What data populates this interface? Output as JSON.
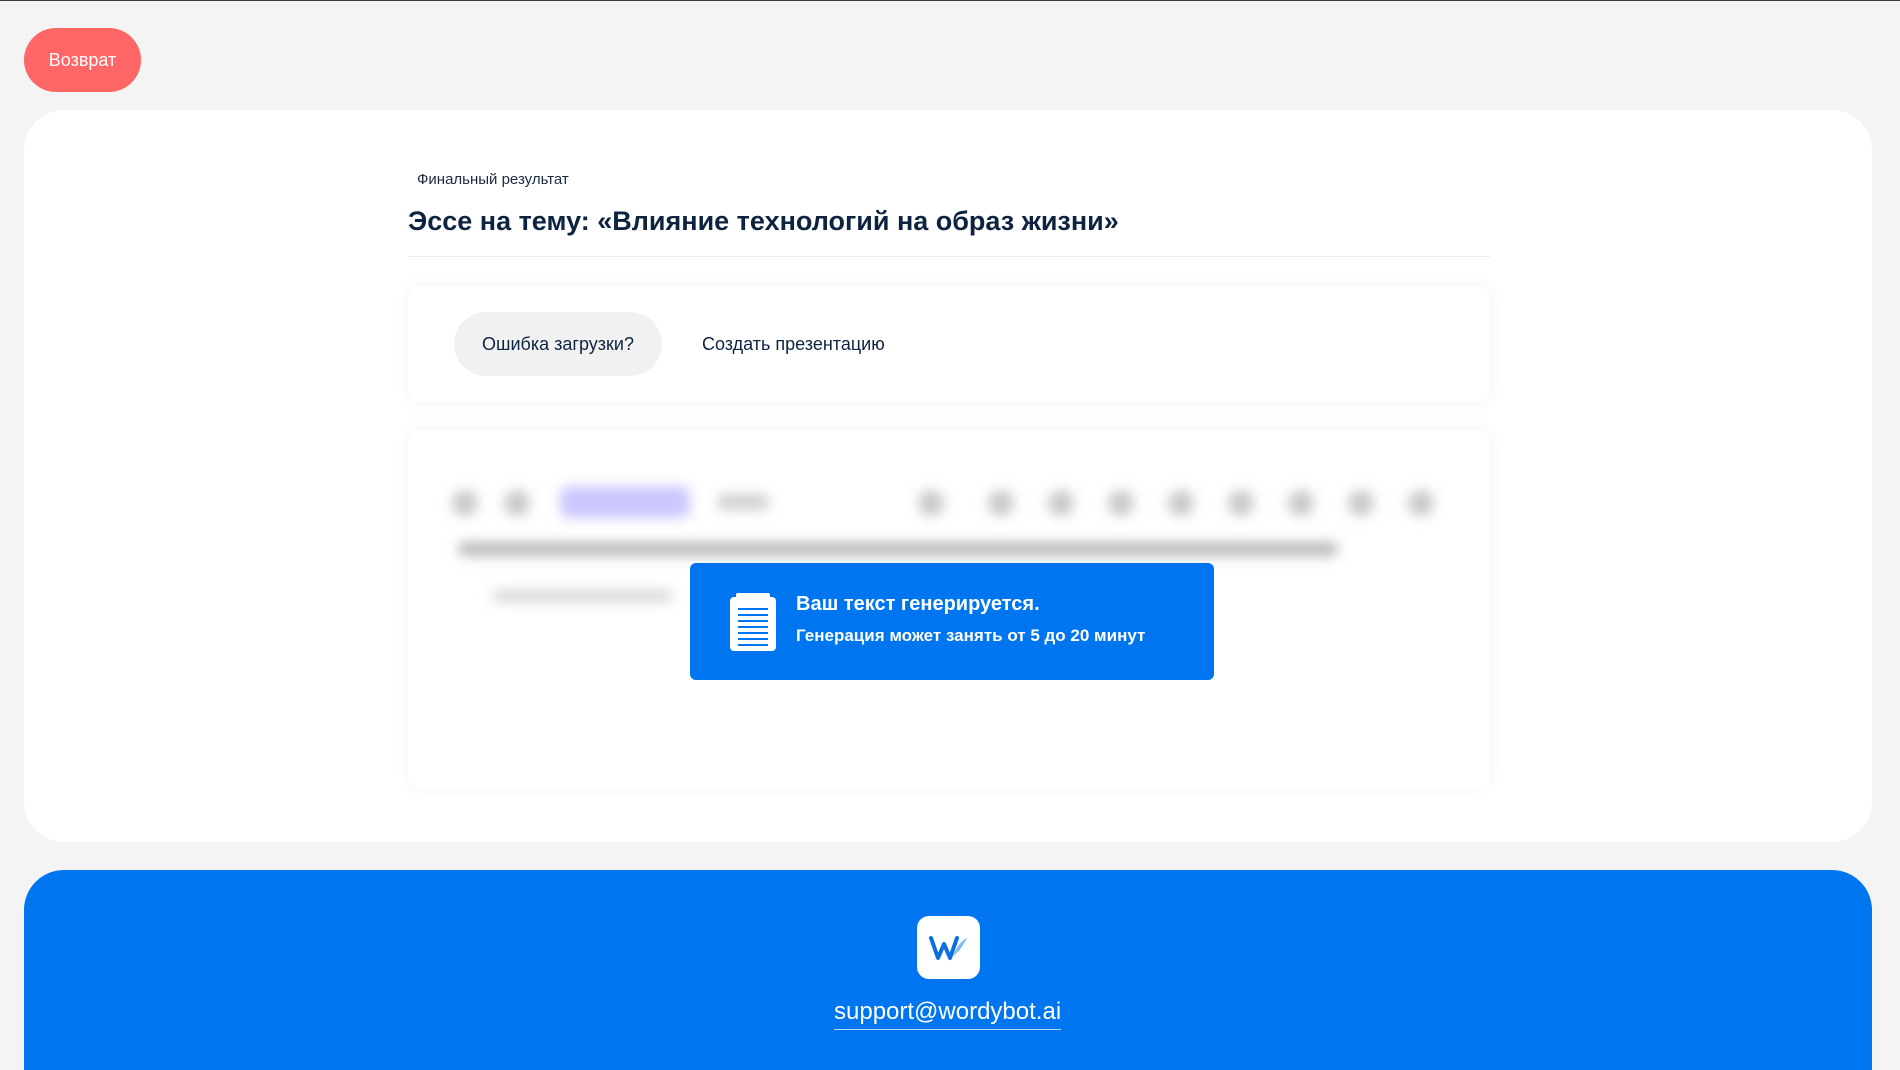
{
  "header": {
    "back_label": "Возврат"
  },
  "result": {
    "label": "Финальный результат",
    "title": "Эссе на тему: «Влияние технологий на образ жизни»"
  },
  "actions": {
    "error_label": "Ошибка загрузки?",
    "presentation_label": "Создать презентацию"
  },
  "toast": {
    "icon": "document-icon",
    "title": "Ваш текст генерируется.",
    "subtitle": "Генерация может занять от 5 до 20 минут"
  },
  "footer": {
    "logo_icon": "wordybot-logo-icon",
    "support_email": "support@wordybot.ai"
  },
  "colors": {
    "back_button": "#ff6767",
    "brand_blue": "#0075f0",
    "page_bg": "#f4f4f4",
    "text_dark": "#0d2340"
  }
}
